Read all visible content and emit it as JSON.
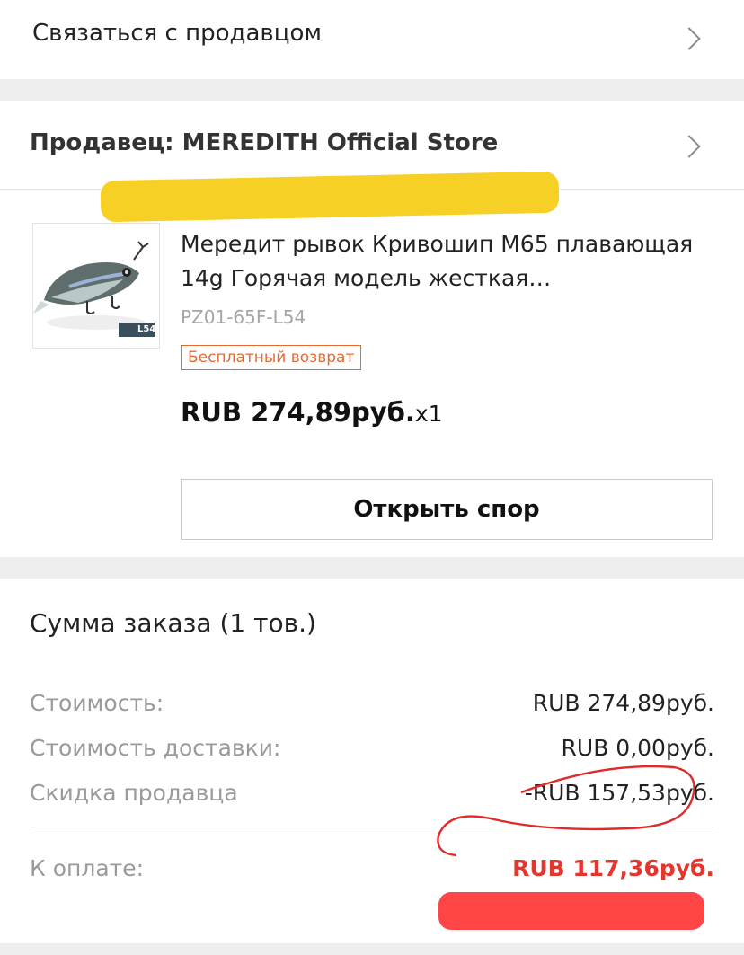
{
  "contact": {
    "label": "Связаться с продавцом"
  },
  "seller": {
    "label": "Продавец: MEREDITH Official Store"
  },
  "product": {
    "title": "Мередит рывок Кривошип М65 плавающая 14g Горячая модель жесткая…",
    "sku": "PZ01-65F-L54",
    "badge": "Бесплатный возврат",
    "price": "RUB 274,89руб.",
    "quantity": "x1",
    "image_tag": "L54"
  },
  "actions": {
    "dispute_label": "Открыть спор"
  },
  "summary": {
    "heading": "Сумма заказа (1 тов.)",
    "cost_label": "Стоимость:",
    "cost_value": "RUB 274,89руб.",
    "shipping_label": "Стоимость доставки:",
    "shipping_value": "RUB 0,00руб.",
    "discount_label": "Скидка продавца",
    "discount_value": "-RUB 157,53руб.",
    "total_label": "К оплате:",
    "total_value": "RUB 117,36руб."
  },
  "colors": {
    "accent_red": "#e2362f",
    "badge_orange": "#e46a35",
    "highlight_yellow": "#f7ce1a"
  }
}
